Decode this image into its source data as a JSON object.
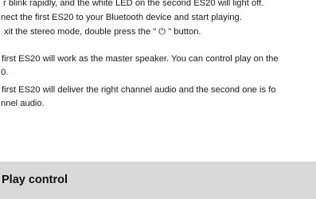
{
  "manual": {
    "lines": [
      "r blink rapidly, and the white LED on the second ES20 will light off.",
      "nect the first ES20 to your Bluetooth device and start playing.",
      "xit the stereo mode, double press the \" ⏻ \" button.",
      "first ES20 will work as the master speaker. You can control play on the",
      "0.",
      "first ES20 will deliver the right channel audio and the second one is fo",
      "nnel audio."
    ],
    "section_title": "Play control"
  }
}
